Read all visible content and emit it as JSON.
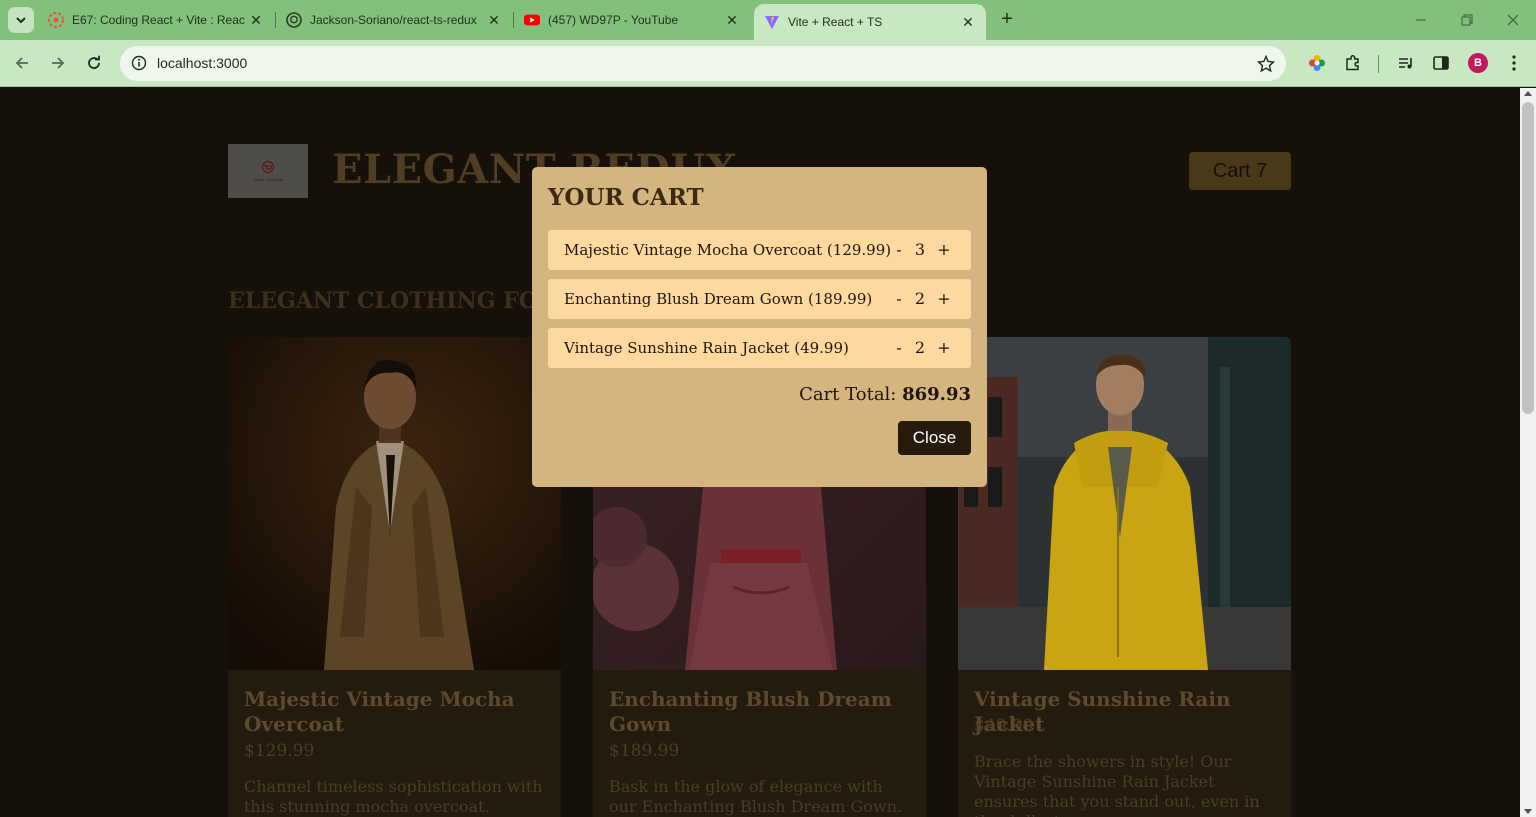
{
  "browser": {
    "tabs": [
      {
        "title": "E67: Coding React + Vite : Reac",
        "icon": "udemy-icon"
      },
      {
        "title": "Jackson-Soriano/react-ts-redux",
        "icon": "github-icon"
      },
      {
        "title": "(457) WD97P - YouTube",
        "icon": "youtube-icon"
      },
      {
        "title": "Vite + React + TS",
        "icon": "vite-icon",
        "active": true
      }
    ],
    "url": "localhost:3000",
    "profile_initial": "B"
  },
  "page": {
    "title": "ELEGANT REDUX",
    "logo_text": "Online Shopping",
    "cart_button": "Cart 7",
    "section_title": "ELEGANT CLOTHING FOR EVERYONE",
    "products": [
      {
        "name": "Majestic Vintage Mocha Overcoat",
        "price": "$129.99",
        "description": "Channel timeless sophistication with this stunning mocha overcoat."
      },
      {
        "name": "Enchanting Blush Dream Gown",
        "price": "$189.99",
        "description": "Bask in the glow of elegance with our Enchanting Blush Dream Gown."
      },
      {
        "name": "Vintage Sunshine Rain Jacket",
        "price": "$49.99",
        "description": "Brace the showers in style! Our Vintage Sunshine Rain Jacket ensures that you stand out, even in the dullest"
      }
    ]
  },
  "cart_modal": {
    "title": "YOUR CART",
    "items": [
      {
        "label": "Majestic Vintage Mocha Overcoat (129.99)",
        "quantity": "3",
        "minus": "-",
        "plus": "+"
      },
      {
        "label": "Enchanting Blush Dream Gown (189.99)",
        "quantity": "2",
        "minus": "-",
        "plus": "+"
      },
      {
        "label": "Vintage Sunshine Rain Jacket (49.99)",
        "quantity": "2",
        "minus": "-",
        "plus": "+"
      }
    ],
    "total_label": "Cart Total:",
    "total_value": "869.93",
    "close_label": "Close"
  },
  "colors": {
    "chrome": "#83c07c",
    "toolbar": "#c9e7c3",
    "page_bg": "#15100a",
    "modal_bg": "#d5b57f",
    "cart_item_bg": "#fdd9a0",
    "close_button": "#261a0c"
  }
}
